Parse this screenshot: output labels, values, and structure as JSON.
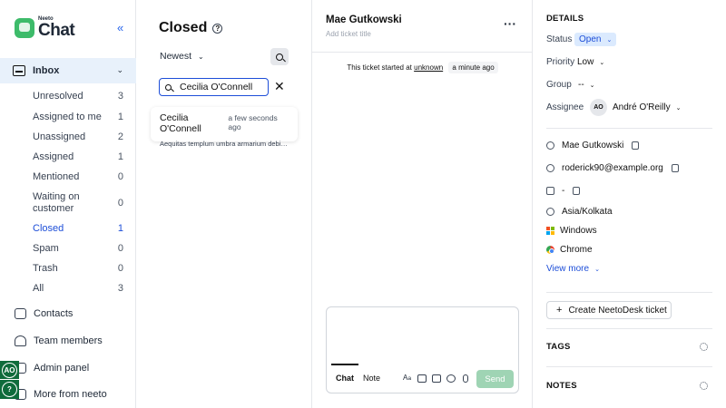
{
  "brand": {
    "small": "Neeto",
    "big": "Chat",
    "accent": "#3dbb6a"
  },
  "sidebar": {
    "inbox_label": "Inbox",
    "items": [
      {
        "label": "Unresolved",
        "count": "3"
      },
      {
        "label": "Assigned to me",
        "count": "1"
      },
      {
        "label": "Unassigned",
        "count": "2"
      },
      {
        "label": "Assigned",
        "count": "1"
      },
      {
        "label": "Mentioned",
        "count": "0"
      },
      {
        "label": "Waiting on customer",
        "count": "0"
      },
      {
        "label": "Closed",
        "count": "1"
      },
      {
        "label": "Spam",
        "count": "0"
      },
      {
        "label": "Trash",
        "count": "0"
      },
      {
        "label": "All",
        "count": "3"
      }
    ],
    "links": [
      {
        "label": "Contacts"
      },
      {
        "label": "Team members"
      },
      {
        "label": "Admin panel"
      },
      {
        "label": "More from neeto"
      }
    ],
    "user_initials": "AO",
    "help_glyph": "?"
  },
  "list": {
    "title": "Closed",
    "sort_label": "Newest",
    "search_value": "Cecilia O'Connell",
    "tickets": [
      {
        "name": "Cecilia O'Connell",
        "time": "a few seconds ago",
        "preview": "Aequitas templum umbra armarium debitis…"
      }
    ]
  },
  "chat": {
    "customer_name": "Mae Gutkowski",
    "title_placeholder": "Add ticket title",
    "started_prefix": "This ticket started at",
    "started_link": "unknown",
    "started_ago": "a minute ago",
    "tabs": {
      "chat": "Chat",
      "note": "Note"
    },
    "send_label": "Send"
  },
  "details": {
    "heading": "DETAILS",
    "status_label": "Status",
    "status_value": "Open",
    "priority_label": "Priority",
    "priority_value": "Low",
    "group_label": "Group",
    "group_value": "--",
    "assignee_label": "Assignee",
    "assignee_initials": "AO",
    "assignee_name": "André O'Reilly",
    "contact_name": "Mae Gutkowski",
    "email": "roderick90@example.org",
    "phone": "-",
    "timezone": "Asia/Kolkata",
    "os": "Windows",
    "browser": "Chrome",
    "view_more": "View more",
    "create_ticket": "Create NeetoDesk ticket",
    "tags_heading": "TAGS",
    "notes_heading": "NOTES"
  }
}
